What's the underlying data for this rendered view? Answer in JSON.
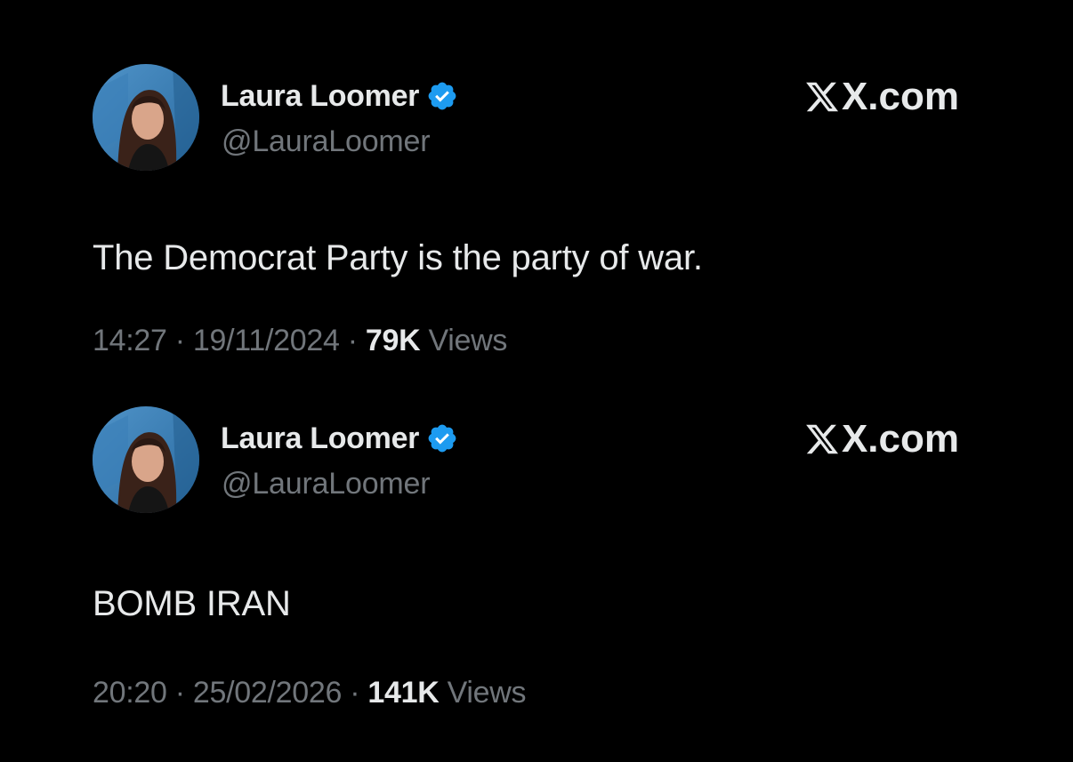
{
  "colors": {
    "background": "#000000",
    "primary_text": "#e7e9ea",
    "secondary_text": "#71767b",
    "verified_badge": "#1d9bf0"
  },
  "tweets": [
    {
      "author": {
        "name": "Laura Loomer",
        "handle": "@LauraLoomer",
        "verified_icon": "verified-badge-icon"
      },
      "brand": "X.com",
      "text": "The Democrat Party is the party of war.",
      "time": "14:27",
      "sep1": " · ",
      "date": "19/11/2024",
      "sep2": " · ",
      "views_count": "79K",
      "views_label": " Views"
    },
    {
      "author": {
        "name": "Laura Loomer",
        "handle": "@LauraLoomer",
        "verified_icon": "verified-badge-icon"
      },
      "brand": "X.com",
      "text": "BOMB IRAN",
      "time": "20:20",
      "sep1": " · ",
      "date": "25/02/2026",
      "sep2": " · ",
      "views_count": "141K",
      "views_label": " Views"
    }
  ]
}
